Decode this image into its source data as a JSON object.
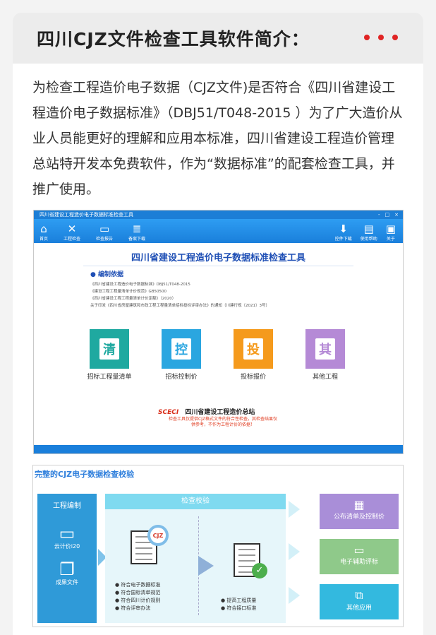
{
  "heading": "四川CJZ文件检查工具软件简介：",
  "intro": "为检查工程造价电子数据（CJZ文件)是否符合《四川省建设工程造价电子数据标准》（DBJ51/T048-2015 ）为了广大造价从业人员能更好的理解和应用本标准，四川省建设工程造价管理总站特开发本免费软件，作为“数据标准”的配套检查工具，并推广使用。",
  "app": {
    "window_title": "四川省建设工程造价电子数据标准检查工具",
    "window_controls": [
      "-",
      "□",
      "×"
    ],
    "toolbar_left": [
      {
        "icon": "home-icon",
        "label": "首页"
      },
      {
        "icon": "tools-icon",
        "label": "工程检查"
      },
      {
        "icon": "monitor-icon",
        "label": "检查报告"
      },
      {
        "icon": "server-icon",
        "label": "备案下载"
      }
    ],
    "toolbar_right": [
      {
        "icon": "download-icon",
        "label": "控件下载"
      },
      {
        "icon": "doc-icon",
        "label": "使用帮助"
      },
      {
        "icon": "info-icon",
        "label": "关于"
      }
    ],
    "main_title": "四川省建设工程造价电子数据标准检查工具",
    "basis_heading": "● 编制依据",
    "basis": [
      "《四川省建设工程造价电子数据标准》DBJ51/T048-2015",
      "《建设工程工程量清单计价规范》GB50500",
      "《四川省建设工程工程量清单计价定额》（2020）",
      "关于印发《四川省房屋建筑和市政工程工程量清单招标投标评审办法》的通知（川建行规〔2021〕3号）"
    ],
    "tiles": [
      {
        "char": "清",
        "label": "招标工程量清单",
        "color": "#1fa9a0"
      },
      {
        "char": "控",
        "label": "招标控制价",
        "color": "#2aa6e0"
      },
      {
        "char": "投",
        "label": "投标报价",
        "color": "#f59a1c"
      },
      {
        "char": "其",
        "label": "其他工程",
        "color": "#b58ad6"
      }
    ],
    "org_logo": "SCECI",
    "org_name": "四川省建设工程造价总站",
    "notice": "检查工具仅提供CJZ格式文件的符合性检查，其检查结果仅供参考，不作为工程计价的依据！"
  },
  "flow": {
    "title": "完整的CJZ电子数据检查校验",
    "left_heading": "工程编制",
    "left_items": [
      {
        "icon": "monitor-icon",
        "label": "云计价i20"
      },
      {
        "icon": "files-icon",
        "label": "成果文件"
      }
    ],
    "mid_heading": "检查校验",
    "badge": "CJZ",
    "checks_left": [
      "● 符合电子数据标准",
      "● 符合国标清单规范",
      "● 符合四川计价规则",
      "● 符合评审办法"
    ],
    "checks_right": [
      "● 提高工程质量",
      "● 符合接口标准"
    ],
    "outputs": [
      {
        "icon": "building-icon",
        "label": "公布清单及控制价",
        "color": "#a98ed8"
      },
      {
        "icon": "screen-icon",
        "label": "电子辅助评标",
        "color": "#8fc98a"
      },
      {
        "icon": "network-icon",
        "label": "其他应用",
        "color": "#33b9df"
      }
    ]
  }
}
